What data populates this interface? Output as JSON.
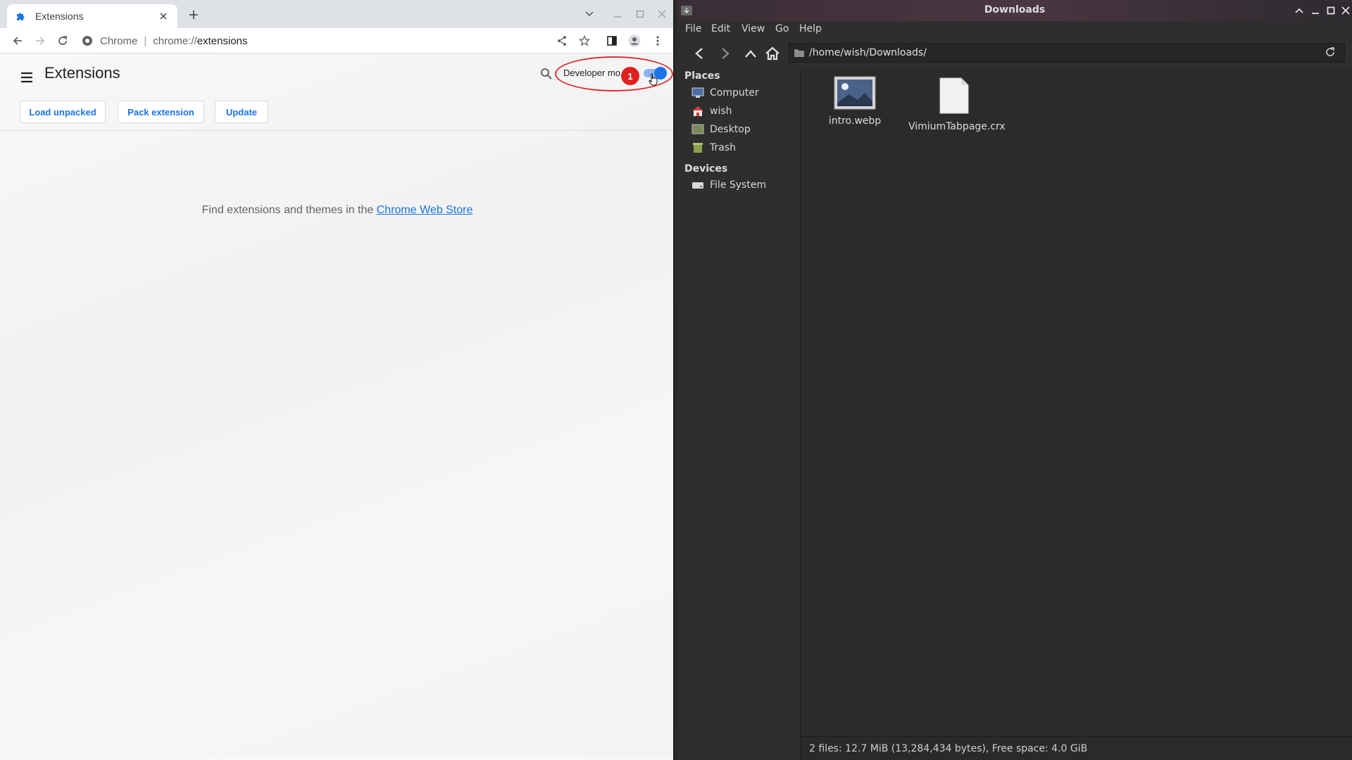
{
  "chrome": {
    "tab_title": "Extensions",
    "omnibox_site": "Chrome",
    "omnibox_url_prefix": "chrome://",
    "omnibox_url_path": "extensions",
    "page_title": "Extensions",
    "developer_mode_label": "Developer mo",
    "developer_mode_on": true,
    "buttons": {
      "load_unpacked": "Load unpacked",
      "pack_extension": "Pack extension",
      "update": "Update"
    },
    "empty_message": "Find extensions and themes in the",
    "web_store_link": "Chrome Web Store",
    "annotation_number": "1"
  },
  "file_manager": {
    "title": "Downloads",
    "menu": [
      "File",
      "Edit",
      "View",
      "Go",
      "Help"
    ],
    "path": "/home/wish/Downloads/",
    "places_heading": "Places",
    "places": [
      "Computer",
      "wish",
      "Desktop",
      "Trash"
    ],
    "devices_heading": "Devices",
    "devices": [
      "File System"
    ],
    "files": [
      {
        "name": "intro.webp",
        "type": "image"
      },
      {
        "name": "VimiumTabpage.crx",
        "type": "document"
      }
    ],
    "status": "2 files: 12.7 MiB (13,284,434 bytes), Free space: 4.0 GiB"
  },
  "colors": {
    "accent": "#1a73e8",
    "annotation": "#e02020"
  }
}
